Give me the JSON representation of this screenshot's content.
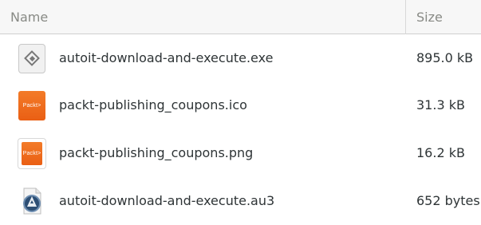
{
  "header": {
    "name_label": "Name",
    "size_label": "Size"
  },
  "files": [
    {
      "name": "autoit-download-and-execute.exe",
      "size": "895.0 kB",
      "icon": "executable-icon"
    },
    {
      "name": "packt-publishing_coupons.ico",
      "size": "31.3 kB",
      "icon": "packt-image-icon",
      "icon_text": "Packt>"
    },
    {
      "name": "packt-publishing_coupons.png",
      "size": "16.2 kB",
      "icon": "packt-image-icon",
      "icon_text": "Packt>"
    },
    {
      "name": "autoit-download-and-execute.au3",
      "size": "652 bytes",
      "icon": "autoit-script-icon"
    }
  ],
  "colors": {
    "header_background": "#f7f7f7",
    "header_text": "#888a85",
    "text": "#2e3436",
    "packt_orange": "#ee6a1f"
  }
}
